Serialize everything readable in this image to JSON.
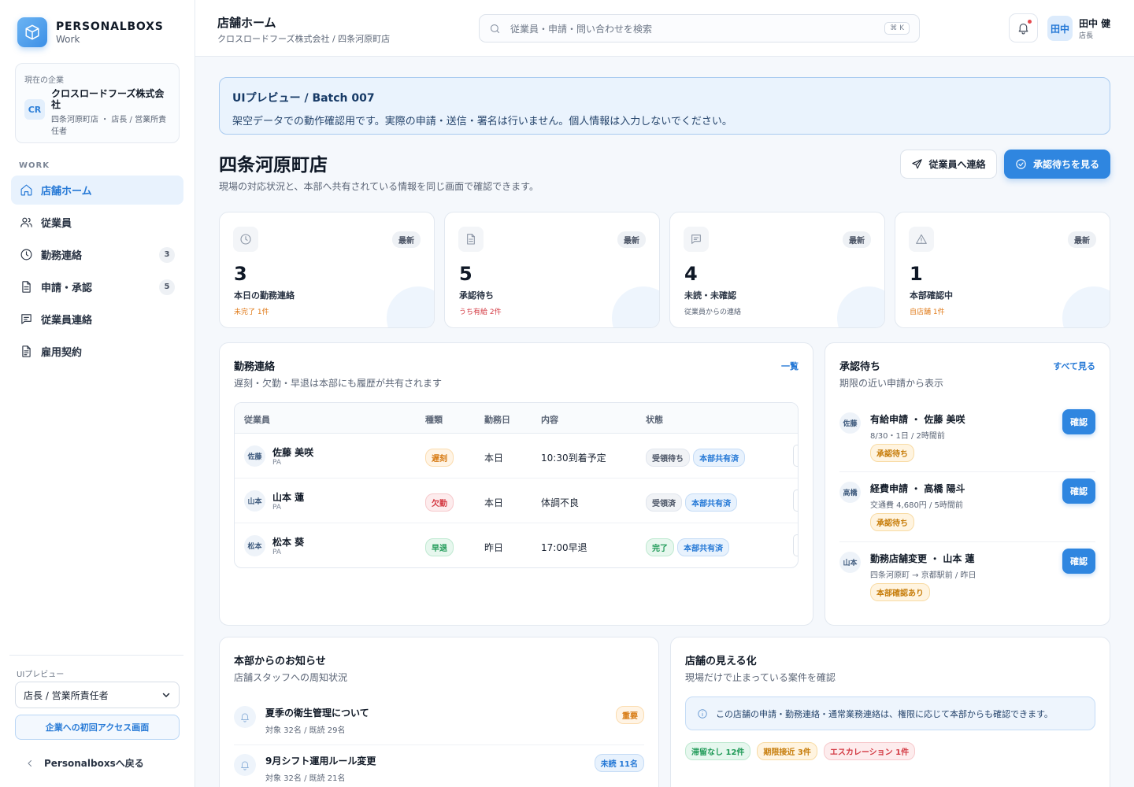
{
  "brand": {
    "name": "PERSONALBOXS",
    "sub": "Work"
  },
  "company": {
    "label": "現在の企業",
    "avatar": "CR",
    "name": "クロスロードフーズ株式会社",
    "role": "四条河原町店 ・ 店長 / 営業所責任者"
  },
  "nav": {
    "section": "WORK",
    "items": [
      {
        "label": "店舗ホーム",
        "icon": "home-icon",
        "badge": ""
      },
      {
        "label": "従業員",
        "icon": "users-icon",
        "badge": ""
      },
      {
        "label": "勤務連絡",
        "icon": "clock-icon",
        "badge": "3"
      },
      {
        "label": "申請・承認",
        "icon": "document-icon",
        "badge": "5"
      },
      {
        "label": "従業員連絡",
        "icon": "message-icon",
        "badge": ""
      },
      {
        "label": "雇用契約",
        "icon": "contract-icon",
        "badge": ""
      }
    ]
  },
  "sidebar_bottom": {
    "preview_label": "UIプレビュー",
    "role_select": "店長 / 営業所責任者",
    "access_button": "企業への初回アクセス画面",
    "back_link": "Personalboxsへ戻る"
  },
  "header": {
    "title": "店舗ホーム",
    "breadcrumb": "クロスロードフーズ株式会社 / 四条河原町店",
    "search_placeholder": "従業員・申請・問い合わせを検索",
    "search_shortcut": "⌘ K",
    "user_avatar": "田中",
    "user_name": "田中 健",
    "user_role": "店長"
  },
  "banner": {
    "title": "UIプレビュー / Batch 007",
    "text": "架空データでの動作確認用です。実際の申請・送信・署名は行いません。個人情報は入力しないでください。"
  },
  "page": {
    "title": "四条河原町店",
    "subtitle": "現場の対応状況と、本部へ共有されている情報を同じ画面で確認できます。",
    "contact_button": "従業員へ連絡",
    "approve_button": "承認待ちを見る"
  },
  "stats": [
    {
      "icon": "clock-icon",
      "badge": "最新",
      "value": "3",
      "label": "本日の勤務連絡",
      "note": "未完了 1件",
      "note_color": "#e07b1a"
    },
    {
      "icon": "document-icon",
      "badge": "最新",
      "value": "5",
      "label": "承認待ち",
      "note": "うち有給 2件",
      "note_color": "#d43c45"
    },
    {
      "icon": "message-icon",
      "badge": "最新",
      "value": "4",
      "label": "未読・未確認",
      "note": "従業員からの連絡",
      "note_color": "#5b6576"
    },
    {
      "icon": "alert-icon",
      "badge": "最新",
      "value": "1",
      "label": "本部確認中",
      "note": "自店舗 1件",
      "note_color": "#e07b1a"
    }
  ],
  "attendance": {
    "title": "勤務連絡",
    "subtitle": "遅刻・欠勤・早退は本部にも履歴が共有されます",
    "link": "一覧",
    "columns": [
      "従業員",
      "種類",
      "勤務日",
      "内容",
      "状態"
    ],
    "rows": [
      {
        "avatar": "佐藤",
        "name": "佐藤 美咲",
        "type_label": "PA",
        "kind": "遅刻",
        "kind_style": "p-orange",
        "date": "本日",
        "content": "10:30到着予定",
        "status1": "受領待ち",
        "status1_style": "p-gray",
        "status2": "本部共有済",
        "status2_style": "p-blue"
      },
      {
        "avatar": "山本",
        "name": "山本 蓮",
        "type_label": "PA",
        "kind": "欠勤",
        "kind_style": "p-red",
        "date": "本日",
        "content": "体調不良",
        "status1": "受領済",
        "status1_style": "p-gray",
        "status2": "本部共有済",
        "status2_style": "p-blue"
      },
      {
        "avatar": "松本",
        "name": "松本 葵",
        "type_label": "PA",
        "kind": "早退",
        "kind_style": "p-green",
        "date": "昨日",
        "content": "17:00早退",
        "status1": "完了",
        "status1_style": "p-green",
        "status2": "本部共有済",
        "status2_style": "p-blue"
      }
    ]
  },
  "approvals": {
    "title": "承認待ち",
    "subtitle": "期限の近い申請から表示",
    "link": "すべて見る",
    "button_label": "確認",
    "items": [
      {
        "avatar": "佐藤",
        "title": "有給申請 ・ 佐藤 美咲",
        "meta": "8/30・1日 / 2時間前",
        "pill": "承認待ち"
      },
      {
        "avatar": "高橋",
        "title": "経費申請 ・ 高橋 陽斗",
        "meta": "交通費 4,680円 / 5時間前",
        "pill": "承認待ち"
      },
      {
        "avatar": "山本",
        "title": "勤務店舗変更 ・ 山本 蓮",
        "meta": "四条河原町 → 京都駅前 / 昨日",
        "pill": "本部確認あり"
      }
    ]
  },
  "notices": {
    "title": "本部からのお知らせ",
    "subtitle": "店舗スタッフへの周知状況",
    "items": [
      {
        "title": "夏季の衛生管理について",
        "meta": "対象 32名 / 既読 29名",
        "pill": "重要",
        "pill_style": "p-orange"
      },
      {
        "title": "9月シフト運用ルール変更",
        "meta": "対象 32名 / 既読 21名",
        "pill": "未読 11名",
        "pill_style": "p-blue"
      }
    ]
  },
  "visibility": {
    "title": "店舗の見える化",
    "subtitle": "現場だけで止まっている案件を確認",
    "info": "この店舗の申請・勤務連絡・通常業務連絡は、権限に応じて本部からも確認できます。",
    "pills": [
      {
        "label": "滞留なし 12件",
        "style": "p-teal"
      },
      {
        "label": "期限接近 3件",
        "style": "p-amber"
      },
      {
        "label": "エスカレーション 1件",
        "style": "p-red"
      }
    ]
  }
}
